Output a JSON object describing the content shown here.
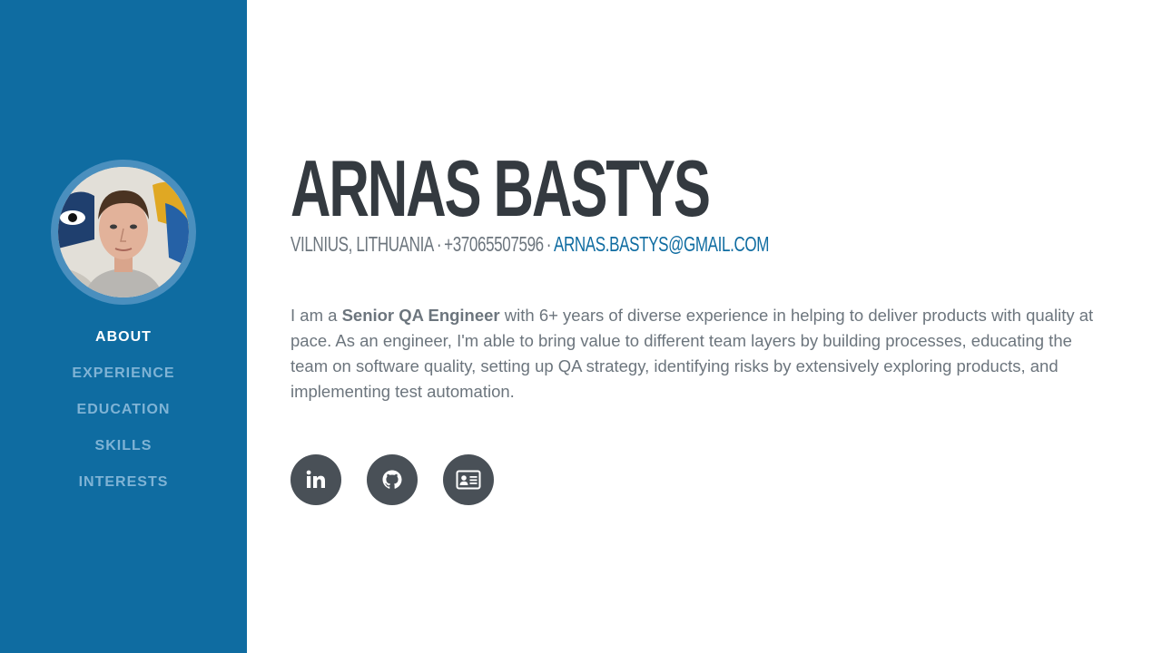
{
  "profile": {
    "name": "ARNAS BASTYS",
    "location": "VILNIUS, LITHUANIA",
    "phone": "+37065507596",
    "separator": "·",
    "email": "ARNAS.BASTYS@GMAIL.COM"
  },
  "sidebar": {
    "nav_items": [
      {
        "label": "ABOUT",
        "active": true
      },
      {
        "label": "EXPERIENCE",
        "active": false
      },
      {
        "label": "EDUCATION",
        "active": false
      },
      {
        "label": "SKILLS",
        "active": false
      },
      {
        "label": "INTERESTS",
        "active": false
      }
    ]
  },
  "about": {
    "prefix": "I am a ",
    "role": "Senior QA Engineer",
    "text": " with 6+ years of diverse experience in helping to deliver products with quality at pace. As an engineer, I'm able to bring value to different team layers by building processes, educating the team on software quality, setting up QA strategy, identifying risks by extensively exploring products, and implementing test automation."
  },
  "social": [
    {
      "icon": "linkedin-icon"
    },
    {
      "icon": "github-icon"
    },
    {
      "icon": "id-card-icon"
    }
  ],
  "colors": {
    "sidebar_bg": "#0f6ca1",
    "accent": "#0f6ca1",
    "heading": "#343a40",
    "text": "#6c757d",
    "icon_bg": "#495057"
  }
}
